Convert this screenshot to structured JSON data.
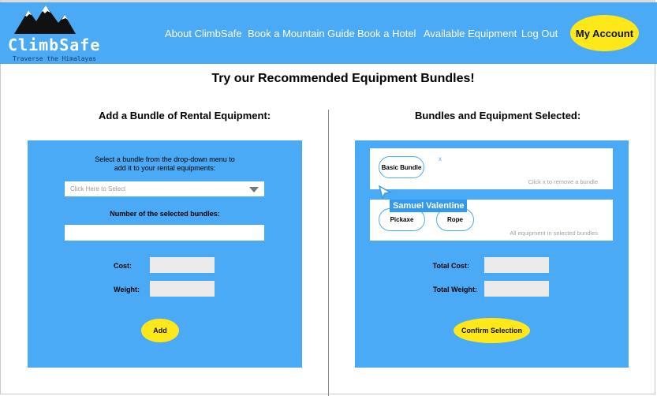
{
  "header": {
    "logo_name": "ClimbSafe",
    "logo_tagline": "Traverse the Himalayas",
    "nav": [
      {
        "label": "About ClimbSafe"
      },
      {
        "label": "Book a Mountain Guide"
      },
      {
        "label": "Book a Hotel"
      },
      {
        "label": "Available Equipment"
      },
      {
        "label": "Log Out"
      }
    ],
    "account_label": "My Account"
  },
  "page_title": "Try our Recommended Equipment Bundles!",
  "left": {
    "title": "Add a Bundle of Rental Equipment:",
    "instruction_line1": "Select a bundle from the drop-down menu to",
    "instruction_line2": "add it to your rental equipments:",
    "dropdown_placeholder": "Click Here to Select",
    "number_label": "Number of the selected bundles:",
    "number_value": "",
    "cost_label": "Cost:",
    "cost_value": "",
    "weight_label": "Weight:",
    "weight_value": "",
    "add_label": "Add"
  },
  "right": {
    "title": "Bundles and Equipment Selected:",
    "bundles": [
      {
        "label": "Basic Bundle",
        "remove": "x"
      }
    ],
    "bundles_hint": "Click x to remove a bundle",
    "equipment": [
      {
        "label": "Pickaxe"
      },
      {
        "label": "Rope"
      }
    ],
    "equipment_hint": "All equipment in selected bundles",
    "total_cost_label": "Total Cost:",
    "total_cost_value": "",
    "total_weight_label": "Total Weight:",
    "total_weight_value": "",
    "confirm_label": "Confirm Selection"
  },
  "overlay": {
    "user_tag": "Samuel Valentine"
  },
  "colors": {
    "primary_blue": "#4aaaf5",
    "accent_yellow": "#ffe81a",
    "user_tag_blue": "#3399ee"
  },
  "icons": [
    "mountain-logo-icon",
    "dropdown-arrow-icon",
    "mouse-cursor-icon"
  ]
}
